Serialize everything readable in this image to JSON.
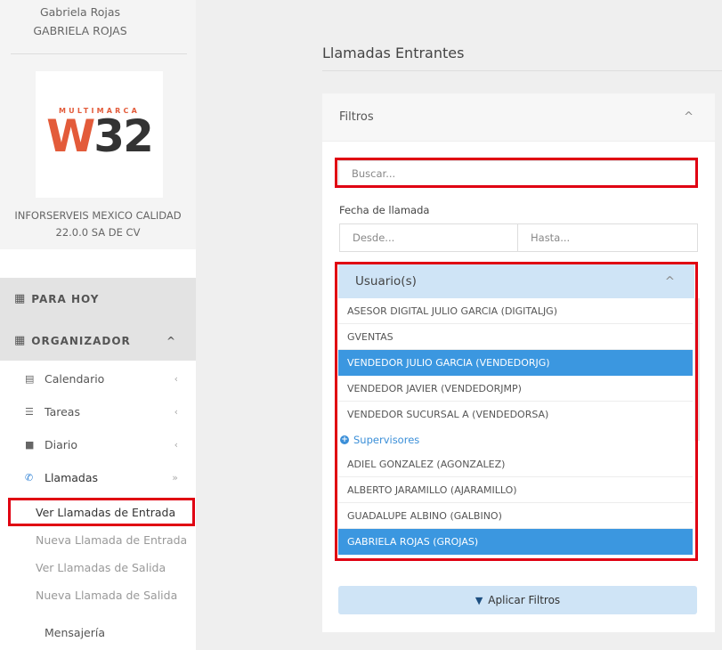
{
  "sidebar": {
    "user_display": "Gabriela Rojas",
    "user_upper": "GABRIELA ROJAS",
    "logo_top": "MULTIMARCA",
    "logo_main_w": "W",
    "logo_main_num": "32",
    "company_line1": "INFORSERVEIS MEXICO CALIDAD",
    "company_line2": "22.0.0 SA DE CV",
    "para_hoy": "PARA HOY",
    "organizador": "ORGANIZADOR",
    "items": [
      {
        "label": "Calendario",
        "icon": "calendar-icon"
      },
      {
        "label": "Tareas",
        "icon": "tasks-icon"
      },
      {
        "label": "Diario",
        "icon": "book-icon"
      },
      {
        "label": "Llamadas",
        "icon": "phone-icon"
      }
    ],
    "subitems": [
      "Ver Llamadas de Entrada",
      "Nueva Llamada de Entrada",
      "Ver Llamadas de Salida",
      "Nueva Llamada de Salida"
    ],
    "mensajeria": "Mensajería"
  },
  "main": {
    "title": "Llamadas Entrantes",
    "filters": {
      "header": "Filtros",
      "search_placeholder": "Buscar...",
      "date_label": "Fecha de llamada",
      "from_placeholder": "Desde...",
      "to_placeholder": "Hasta...",
      "users_header": "Usuario(s)",
      "users": [
        {
          "label": "ASESOR DIGITAL JULIO GARCIA (DIGITALJG)",
          "selected": false
        },
        {
          "label": "GVENTAS",
          "selected": false
        },
        {
          "label": "VENDEDOR JULIO GARCIA (VENDEDORJG)",
          "selected": true
        },
        {
          "label": "VENDEDOR JAVIER (VENDEDORJMP)",
          "selected": false
        },
        {
          "label": "VENDEDOR SUCURSAL A (VENDEDORSA)",
          "selected": false
        }
      ],
      "group_label": "Supervisores",
      "supervisors": [
        {
          "label": "ADIEL GONZALEZ (AGONZALEZ)",
          "selected": false
        },
        {
          "label": "ALBERTO JARAMILLO (AJARAMILLO)",
          "selected": false
        },
        {
          "label": "GUADALUPE ALBINO (GALBINO)",
          "selected": false
        },
        {
          "label": "GABRIELA ROJAS (GROJAS)",
          "selected": true
        }
      ],
      "apply_label": "Aplicar Filtros"
    }
  },
  "colors": {
    "highlight": "#e00012",
    "selected": "#3b97e0",
    "header_blue": "#cfe4f6",
    "brand": "#e35b3a"
  }
}
